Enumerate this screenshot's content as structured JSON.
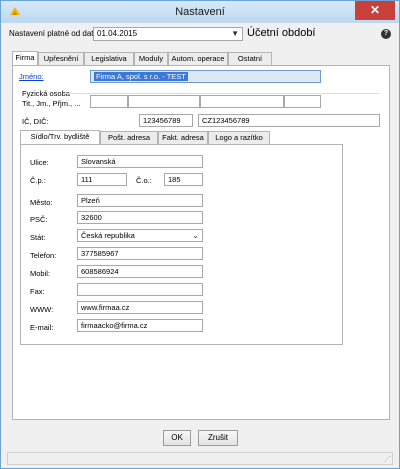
{
  "window": {
    "title": "Nastavení",
    "close": "✕"
  },
  "top": {
    "valid_from_label": "Nastavení platné od data:",
    "valid_from_value": "01.04.2015",
    "period_title": "Účetní období",
    "help": "?"
  },
  "tabs": [
    "Firma",
    "Upřesnění",
    "Legislativa",
    "Moduly",
    "Autom. operace",
    "Ostatní"
  ],
  "firma": {
    "name_label": "Jméno:",
    "name_value": "Firma A, spol. s r.o. - TEST",
    "person_label": "Fyzická osoba",
    "person_fields_label": "Tit., Jm., Přjm., ...",
    "ic_label": "IČ, DIČ:",
    "ic_value": "123456789",
    "dic_value": "CZ123456789"
  },
  "address_tabs": [
    "Sídlo/Trv. bydliště",
    "Pošt. adresa",
    "Fakt. adresa",
    "Logo a razítko"
  ],
  "address": {
    "street_label": "Ulice:",
    "street": "Slovanská",
    "cp_label": "Č.p.:",
    "cp": "111",
    "co_label": "Č.o.:",
    "co": "185",
    "city_label": "Město:",
    "city": "Plzeň",
    "zip_label": "PSČ:",
    "zip": "32600",
    "state_label": "Stát:",
    "state": "Česká republika",
    "phone_label": "Telefon:",
    "phone": "377585967",
    "mobile_label": "Mobil:",
    "mobile": "608586924",
    "fax_label": "Fax:",
    "fax": "",
    "www_label": "WWW:",
    "www": "www.firmaa.cz",
    "email_label": "E-mail:",
    "email": "firmaacko@firma.cz"
  },
  "buttons": {
    "ok": "OK",
    "cancel": "Zrušit"
  }
}
